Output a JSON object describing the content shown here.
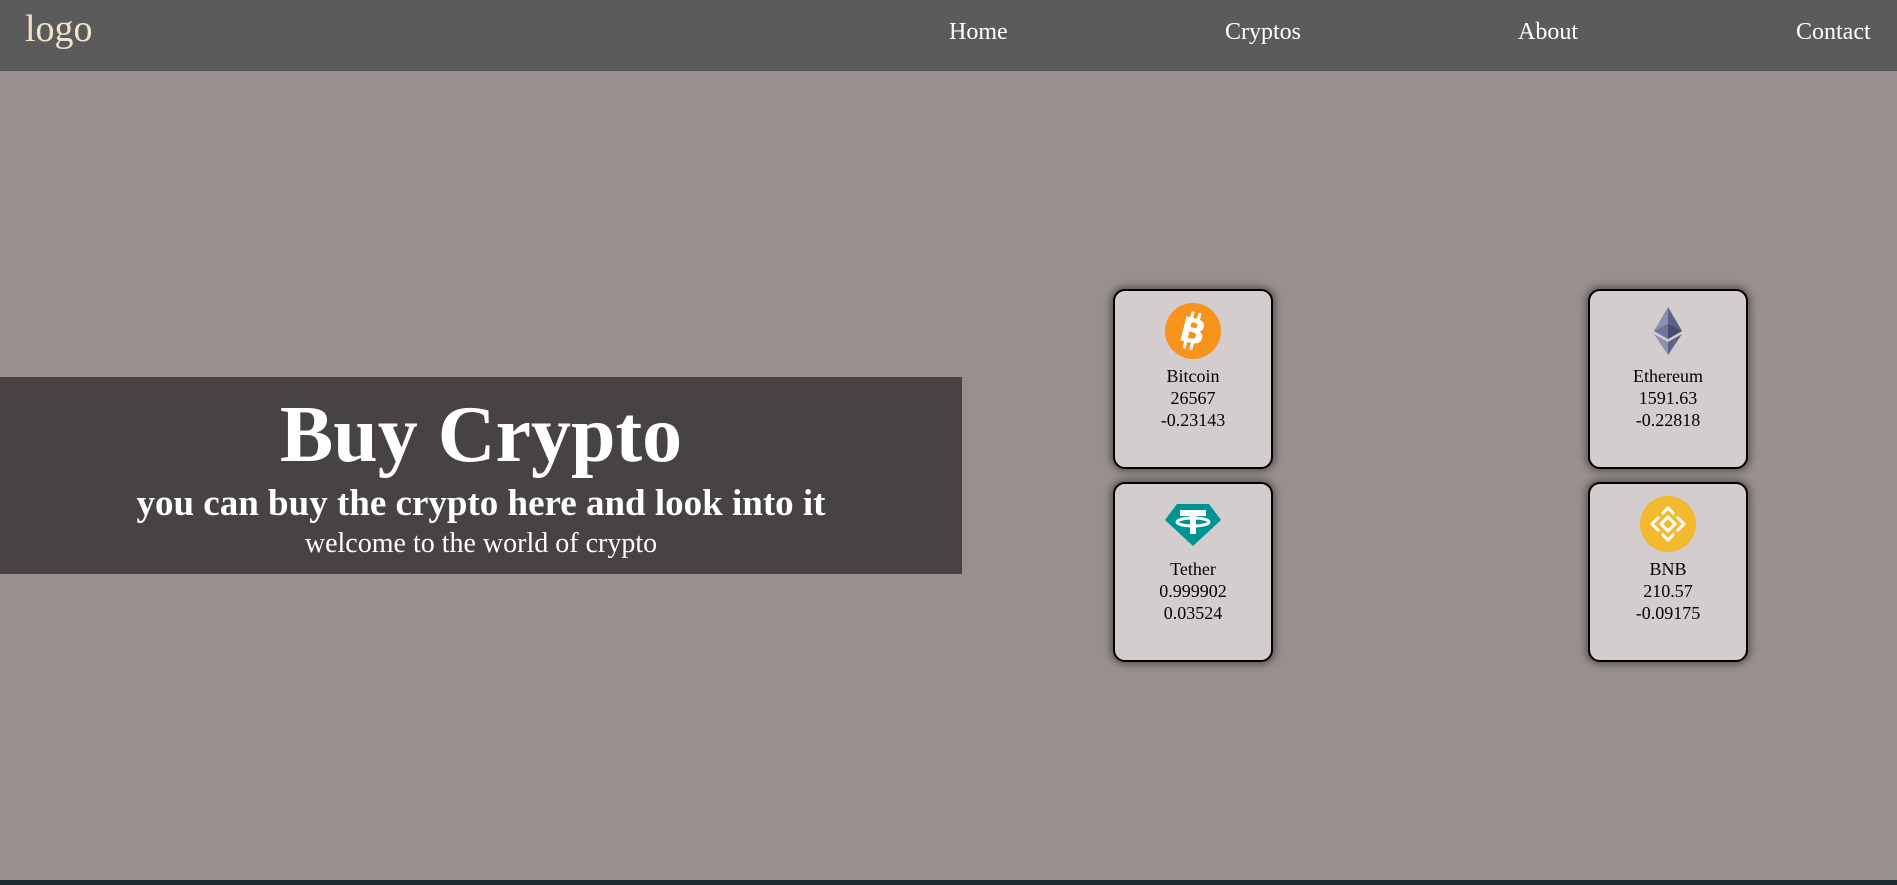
{
  "nav": {
    "logo": "logo",
    "links": [
      "Home",
      "Cryptos",
      "About",
      "Contact"
    ]
  },
  "hero": {
    "title": "Buy Crypto",
    "subtitle": "you can buy the crypto here and look into it",
    "tagline": "welcome to the world of crypto"
  },
  "coins": [
    {
      "name": "Bitcoin",
      "price": "26567",
      "change": "-0.23143",
      "icon": "bitcoin-icon",
      "color": "#f7931a"
    },
    {
      "name": "Ethereum",
      "price": "1591.63",
      "change": "-0.22818",
      "icon": "ethereum-icon",
      "color": "#627eea"
    },
    {
      "name": "Tether",
      "price": "0.999902",
      "change": "0.03524",
      "icon": "tether-icon",
      "color": "#009393"
    },
    {
      "name": "BNB",
      "price": "210.57",
      "change": "-0.09175",
      "icon": "bnb-icon",
      "color": "#f3ba2f"
    }
  ],
  "colors": {
    "navbar": "#5b5b5b",
    "logo": "#f1e3c8",
    "background": "#988f8e",
    "hero_panel": "#474343",
    "card": "#d3cdcd"
  }
}
